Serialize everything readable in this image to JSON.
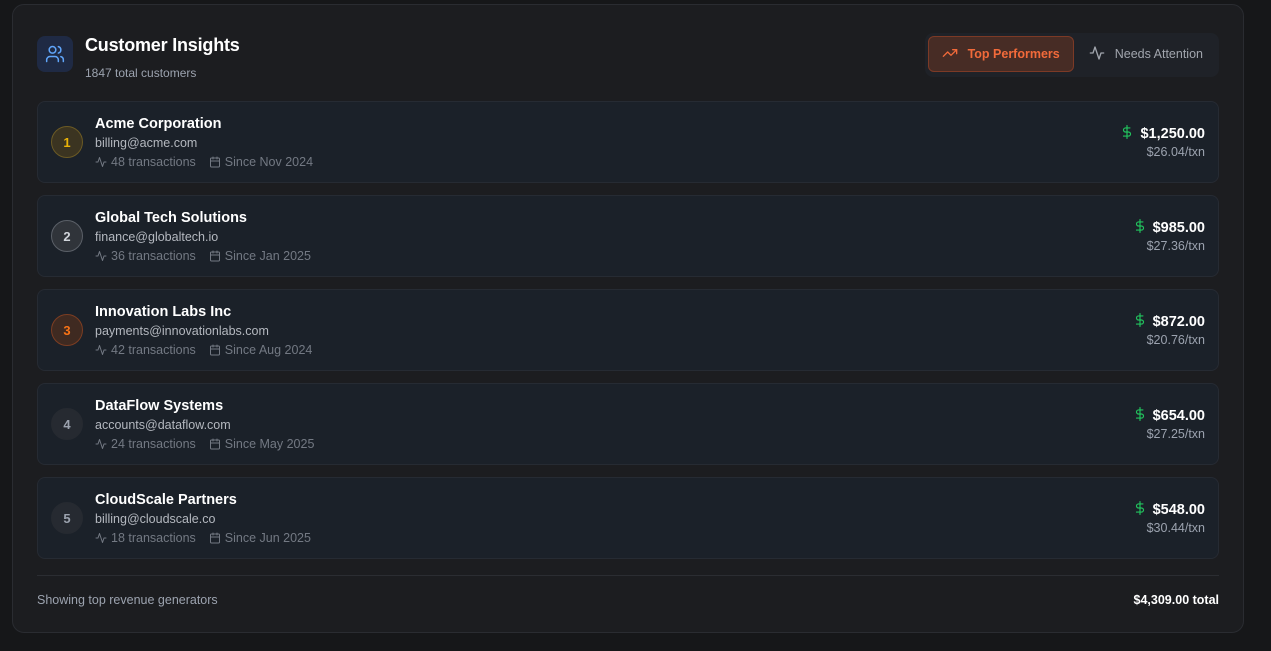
{
  "header": {
    "title": "Customer Insights",
    "subtitle": "1847 total customers",
    "icon": "users-icon"
  },
  "tabs": [
    {
      "label": "Top Performers",
      "icon": "trending-up-icon",
      "active": true
    },
    {
      "label": "Needs Attention",
      "icon": "activity-icon",
      "active": false
    }
  ],
  "customers": [
    {
      "rank": "1",
      "name": "Acme Corporation",
      "email": "billing@acme.com",
      "transactions": "48 transactions",
      "since": "Since Nov 2024",
      "amount": "$1,250.00",
      "per_txn": "$26.04/txn"
    },
    {
      "rank": "2",
      "name": "Global Tech Solutions",
      "email": "finance@globaltech.io",
      "transactions": "36 transactions",
      "since": "Since Jan 2025",
      "amount": "$985.00",
      "per_txn": "$27.36/txn"
    },
    {
      "rank": "3",
      "name": "Innovation Labs Inc",
      "email": "payments@innovationlabs.com",
      "transactions": "42 transactions",
      "since": "Since Aug 2024",
      "amount": "$872.00",
      "per_txn": "$20.76/txn"
    },
    {
      "rank": "4",
      "name": "DataFlow Systems",
      "email": "accounts@dataflow.com",
      "transactions": "24 transactions",
      "since": "Since May 2025",
      "amount": "$654.00",
      "per_txn": "$27.25/txn"
    },
    {
      "rank": "5",
      "name": "CloudScale Partners",
      "email": "billing@cloudscale.co",
      "transactions": "18 transactions",
      "since": "Since Jun 2025",
      "amount": "$548.00",
      "per_txn": "$30.44/txn"
    }
  ],
  "footer": {
    "left": "Showing top revenue generators",
    "right": "$4,309.00 total"
  },
  "colors": {
    "accent": "#f26a3a",
    "money": "#22c55e",
    "icon_blue": "#60a5fa"
  }
}
